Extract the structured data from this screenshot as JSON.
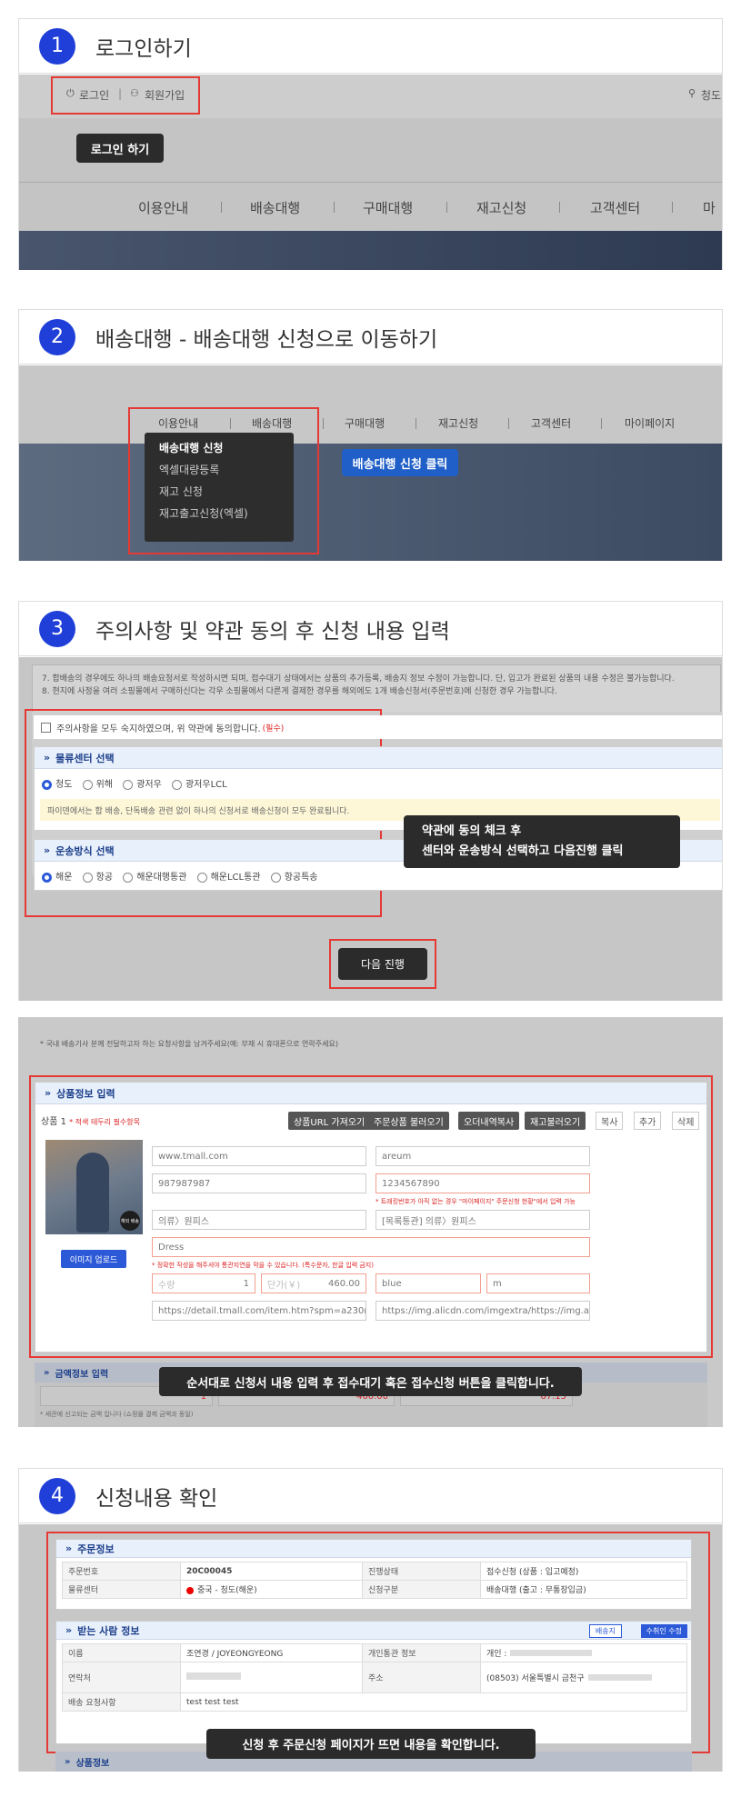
{
  "steps": {
    "s1": {
      "num": "1",
      "title": "로그인하기"
    },
    "s2": {
      "num": "2",
      "title": "배송대행 - 배송대행 신청으로 이동하기"
    },
    "s3": {
      "num": "3",
      "title": "주의사항 및 약관 동의 후 신청 내용 입력"
    },
    "s4": {
      "num": "4",
      "title": "신청내용 확인"
    }
  },
  "s1": {
    "login": "로그인",
    "divider": "|",
    "signup": "회원가입",
    "location": "청도",
    "tooltip": "로그인 하기",
    "nav": [
      "이용안내",
      "배송대행",
      "구매대행",
      "재고신청",
      "고객센터",
      "마"
    ]
  },
  "s2": {
    "nav": [
      "이용안내",
      "배송대행",
      "구매대행",
      "재고신청",
      "고객센터",
      "마이페이지"
    ],
    "menu": [
      "배송대행 신청",
      "엑셀대량등록",
      "재고 신청",
      "재고출고신청(엑셀)"
    ],
    "tooltip": "배송대행 신청 클릭"
  },
  "s3": {
    "notice": "7. 합배송의 경우에도 하나의 배송요청서로 작성하시면 되며, 접수대기 상태에서는 상품의 추가등록, 배송지 정보 수정이 가능합니다. 단, 입고가 완료된 상품의 내용 수정은 불가능합니다.",
    "notice2": "8. 현지에 사정을 여러 소핑몰에서 구매하신다는 각우 소핑몰에서 다른게 결제한 경우를 해외에도 1개 배송신청서(주문번호)에 신청한 경우 가능합니다.",
    "agree": "주의사항을 모두 숙지하였으며, 위 약관에 동의합니다.",
    "required": "(필수)",
    "center_title": "물류센터 선택",
    "centers": [
      "청도",
      "위해",
      "광저우",
      "광저우LCL"
    ],
    "center_note": "파이덴에서는 합 배송, 단독배송 관련 없이 하나의 신청서로 배송신청이 모두 완료됩니다.",
    "ship_title": "운송방식 선택",
    "ships": [
      "해운",
      "항공",
      "해운대행통관",
      "해운LCL통관",
      "항공특송"
    ],
    "tooltip_l1": "약관에 동의 체크 후",
    "tooltip_l2": "센터와 운송방식 선택하고 다음진행 클릭",
    "next": "다음 진행"
  },
  "s3b": {
    "top_note": "* 국내 배송기사 분께 전달하고자 하는 요청사항을 남겨주세요(예: 부재 시 휴대폰으로 연락주세요)",
    "panel_title": "상품정보 입력",
    "product_label": "상품 1",
    "product_req": "* 적색 테두리 필수항목",
    "btns": [
      "상품URL 가져오기",
      "주문상품 불러오기",
      "오더내역복사",
      "재고불러오기"
    ],
    "wbtns": [
      "복사",
      "추가",
      "삭제"
    ],
    "shop": "www.tmall.com",
    "name": "areum",
    "order_no": "987987987",
    "tracking": "1234567890",
    "tracking_note": "* 트래킹번호가 아직 없는 경우 \"마이페이지\" 주문신청 현황\"에서 입력 가능",
    "category": "의류〉원피스",
    "category2": "[목록통관] 의류〉원피스",
    "product_name": "Dress",
    "name_note": "* 정확한 작성을 해주셔야 통관지연을 막을 수 있습니다. (특수문자, 한글 입력 금지)",
    "qty_label": "수량",
    "qty": "1",
    "price_label": "단가(￥)",
    "price": "460.00",
    "color": "blue",
    "size": "m",
    "url1": "https://detail.tmall.com/item.htm?spm=a230r.1.14.6.283772",
    "url2": "https://img.alicdn.com/imgextra/https://img.alicdn.com/imge",
    "upload": "이미지 업로드",
    "badge": "해외 배송",
    "amount_title": "금액정보 입력",
    "amt1": "1",
    "amt2": "460.00",
    "amt3": "67.15",
    "amount_note": "* 세관에 신고되는 금액 입니다 (쇼핑몰 결제 금액과 동일)",
    "tooltip": "순서대로 신청서 내용 입력 후 접수대기 혹은 접수신청 버튼을 클릭합니다."
  },
  "s4": {
    "order_title": "주문정보",
    "order_rows": [
      [
        "주문번호",
        "20C00045",
        "진행상태",
        "접수신청 (상품 : 입고예정)"
      ],
      [
        "물류센터",
        "중국 - 청도(해운)",
        "신청구분",
        "배송대행 (출고 : 무통장입금)"
      ]
    ],
    "recv_title": "받는 사람 정보",
    "btn_addr": "배송지",
    "btn_edit": "수취인 수정",
    "recv_name_label": "이름",
    "recv_name": "조연경 / JOYEONGYEONG",
    "customs_label": "개인통관 정보",
    "customs": "개인 :",
    "phone_label": "연락처",
    "addr_label": "주소",
    "addr": "(08503) 서울특별시 금천구",
    "req_label": "배송 요청사항",
    "req": "test test test",
    "product_title": "상품정보",
    "tooltip": "신청 후 주문신청 페이지가 뜨면 내용을 확인합니다."
  }
}
